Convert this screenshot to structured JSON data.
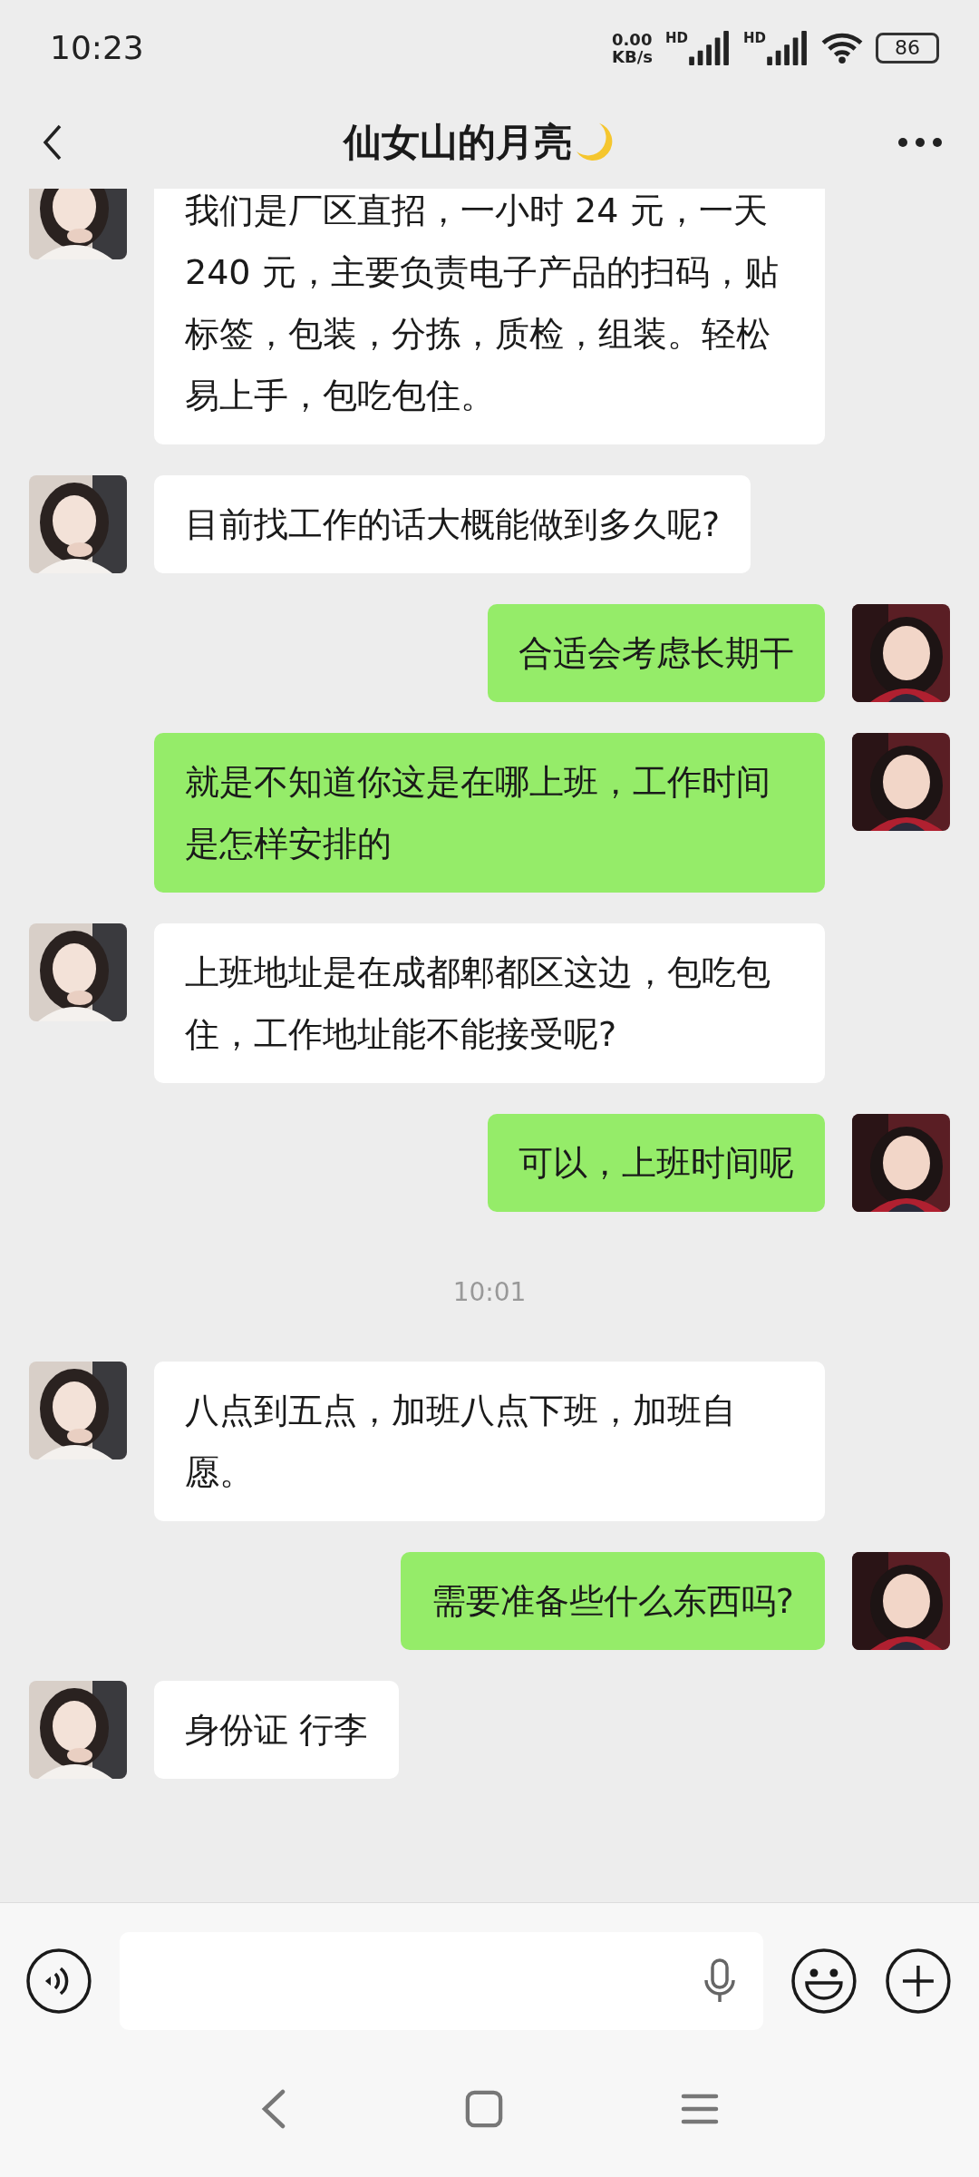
{
  "status_bar": {
    "time": "10:23",
    "net_speed": "0.00",
    "net_unit": "KB/s",
    "sim_labels": [
      "HD",
      "HD"
    ],
    "battery": "86"
  },
  "header": {
    "title": "仙女山的月亮"
  },
  "messages": [
    {
      "kind": "incoming",
      "text": "我们是厂区直招，一小时 24 元，一天 240 元，主要负责电子产品的扫码，贴标签，包装，分拣，质检，组装。轻松易上手，包吃包住。"
    },
    {
      "kind": "incoming",
      "text": "目前找工作的话大概能做到多久呢?"
    },
    {
      "kind": "outgoing",
      "text": "合适会考虑长期干"
    },
    {
      "kind": "outgoing",
      "text": "就是不知道你这是在哪上班，工作时间是怎样安排的"
    },
    {
      "kind": "incoming",
      "text": "上班地址是在成都郫都区这边，包吃包住，工作地址能不能接受呢?"
    },
    {
      "kind": "outgoing",
      "text": "可以，上班时间呢"
    },
    {
      "kind": "time",
      "text": "10:01"
    },
    {
      "kind": "incoming",
      "text": "八点到五点，加班八点下班，加班自愿。"
    },
    {
      "kind": "outgoing",
      "text": "需要准备些什么东西吗?"
    },
    {
      "kind": "incoming",
      "text": "身份证 行李"
    }
  ]
}
